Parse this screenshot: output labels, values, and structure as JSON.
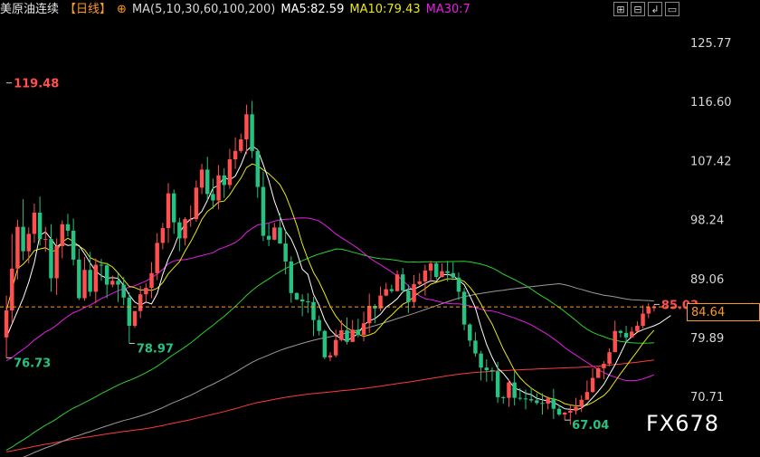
{
  "header": {
    "title": "美原油连续",
    "period": "【日线】",
    "ma_params": "MA(5,10,30,60,100,200)",
    "ma5": "MA5:82.59",
    "ma10": "MA10:79.43",
    "ma30": "MA30:7"
  },
  "toolbar": [
    "⊞",
    "⊟",
    "↲",
    "▭"
  ],
  "current_price": "84.64",
  "watermark": "FX678",
  "colors": {
    "background": "#000000",
    "up": "#ff4f4f",
    "down": "#26c281",
    "ma5": "#ffffff",
    "ma10": "#e8e814",
    "ma30": "#e61ee6",
    "ma60": "#2fd12f",
    "ma100": "#9a9a9a",
    "ma200": "#ff3a3a",
    "price_line": "#ff9a1f"
  },
  "chart_data": {
    "type": "candlestick",
    "ylim": [
      62.0,
      129.0
    ],
    "yticks": [
      "125.77",
      "116.60",
      "107.42",
      "98.24",
      "89.06",
      "79.89",
      "70.71"
    ],
    "grid": false,
    "current_price": 84.64,
    "annotations": [
      {
        "text": "119.48",
        "index": 0,
        "value": 119.48,
        "kind": "high"
      },
      {
        "text": "76.73",
        "index": 0,
        "value": 76.73,
        "kind": "low"
      },
      {
        "text": "78.97",
        "index": 22,
        "value": 78.97,
        "kind": "low"
      },
      {
        "text": "67.04",
        "index": 100,
        "value": 67.04,
        "kind": "low"
      },
      {
        "text": "85.03",
        "index": 116,
        "value": 85.03,
        "kind": "high"
      }
    ],
    "candles": [
      [
        79.9,
        84.1,
        86.4,
        76.7
      ],
      [
        84.1,
        90.6,
        96.0,
        82.2
      ],
      [
        90.6,
        97.1,
        98.2,
        88.9
      ],
      [
        97.1,
        93.3,
        101.4,
        91.9
      ],
      [
        93.3,
        96.0,
        97.0,
        91.4
      ],
      [
        96.0,
        99.3,
        100.7,
        94.6
      ],
      [
        99.3,
        95.2,
        101.8,
        94.2
      ],
      [
        95.2,
        95.2,
        97.1,
        93.2
      ],
      [
        95.2,
        89.1,
        97.5,
        87.0
      ],
      [
        89.1,
        94.1,
        95.3,
        86.5
      ],
      [
        94.1,
        97.5,
        98.1,
        92.2
      ],
      [
        97.5,
        96.5,
        99.1,
        95.6
      ],
      [
        96.5,
        92.0,
        98.4,
        91.1
      ],
      [
        92.0,
        86.0,
        93.7,
        85.7
      ],
      [
        86.0,
        90.4,
        92.4,
        85.6
      ],
      [
        90.4,
        87.0,
        93.2,
        86.3
      ],
      [
        87.0,
        91.2,
        92.2,
        85.2
      ],
      [
        91.2,
        91.1,
        92.1,
        88.7
      ],
      [
        91.1,
        88.1,
        91.5,
        86.0
      ],
      [
        88.1,
        88.7,
        89.5,
        87.7
      ],
      [
        88.7,
        88.1,
        89.8,
        85.4
      ],
      [
        88.1,
        86.1,
        89.3,
        84.9
      ],
      [
        86.1,
        81.7,
        86.9,
        79.0
      ],
      [
        81.7,
        84.0,
        84.0,
        81.4
      ],
      [
        84.0,
        86.6,
        87.9,
        82.9
      ],
      [
        86.6,
        87.6,
        88.3,
        85.4
      ],
      [
        87.6,
        89.9,
        91.6,
        86.0
      ],
      [
        89.9,
        94.6,
        96.1,
        88.8
      ],
      [
        94.6,
        96.9,
        97.7,
        93.6
      ],
      [
        96.9,
        102.3,
        103.9,
        94.6
      ],
      [
        102.3,
        97.8,
        102.9,
        96.0
      ],
      [
        97.8,
        95.3,
        98.5,
        93.3
      ],
      [
        95.3,
        98.3,
        98.6,
        94.2
      ],
      [
        98.3,
        98.3,
        100.4,
        97.1
      ],
      [
        98.3,
        103.2,
        104.3,
        97.9
      ],
      [
        103.2,
        106.0,
        106.9,
        102.2
      ],
      [
        106.0,
        102.2,
        108.0,
        101.2
      ],
      [
        102.2,
        101.2,
        104.6,
        99.9
      ],
      [
        101.2,
        105.1,
        106.7,
        99.8
      ],
      [
        105.1,
        103.6,
        106.2,
        101.6
      ],
      [
        103.6,
        107.6,
        109.2,
        103.0
      ],
      [
        107.6,
        108.9,
        111.0,
        106.1
      ],
      [
        108.9,
        110.7,
        111.6,
        108.6
      ],
      [
        110.7,
        114.6,
        116.1,
        108.4
      ],
      [
        114.6,
        108.9,
        116.7,
        107.8
      ],
      [
        108.9,
        103.3,
        109.1,
        101.6
      ],
      [
        103.3,
        95.7,
        105.7,
        94.9
      ],
      [
        95.7,
        95.1,
        97.6,
        94.1
      ],
      [
        95.1,
        97.0,
        97.7,
        95.0
      ],
      [
        97.0,
        94.5,
        99.2,
        94.5
      ],
      [
        94.5,
        91.7,
        96.5,
        89.7
      ],
      [
        91.7,
        86.8,
        92.5,
        85.3
      ],
      [
        86.8,
        85.8,
        86.9,
        85.7
      ],
      [
        85.8,
        85.5,
        86.6,
        83.2
      ],
      [
        85.5,
        85.4,
        86.8,
        83.7
      ],
      [
        85.4,
        82.6,
        86.2,
        80.1
      ],
      [
        82.6,
        80.9,
        83.3,
        80.2
      ],
      [
        80.9,
        76.8,
        81.1,
        76.5
      ],
      [
        76.8,
        77.1,
        77.6,
        76.2
      ],
      [
        77.1,
        79.5,
        81.1,
        76.8
      ],
      [
        79.5,
        81.0,
        82.6,
        79.3
      ],
      [
        81.0,
        79.2,
        83.0,
        78.8
      ],
      [
        79.2,
        81.1,
        82.6,
        79.2
      ],
      [
        81.1,
        80.3,
        82.8,
        79.9
      ],
      [
        80.3,
        82.1,
        83.9,
        79.3
      ],
      [
        82.1,
        84.8,
        86.7,
        80.6
      ],
      [
        84.8,
        84.4,
        85.1,
        82.1
      ],
      [
        84.4,
        86.4,
        87.8,
        84.0
      ],
      [
        86.4,
        87.4,
        88.4,
        86.3
      ],
      [
        87.4,
        87.1,
        88.1,
        86.8
      ],
      [
        87.1,
        89.7,
        90.3,
        87.0
      ],
      [
        89.7,
        87.2,
        90.7,
        86.8
      ],
      [
        87.2,
        85.4,
        88.1,
        83.7
      ],
      [
        85.4,
        88.2,
        89.6,
        84.7
      ],
      [
        88.2,
        88.6,
        89.9,
        88.0
      ],
      [
        88.6,
        90.3,
        91.2,
        86.4
      ],
      [
        90.3,
        91.4,
        91.8,
        88.5
      ],
      [
        91.4,
        89.3,
        91.6,
        88.9
      ],
      [
        89.3,
        90.2,
        91.4,
        89.2
      ],
      [
        90.2,
        89.9,
        91.8,
        88.6
      ],
      [
        89.9,
        89.2,
        91.6,
        88.8
      ],
      [
        89.2,
        87.0,
        90.0,
        85.7
      ],
      [
        87.0,
        81.9,
        87.6,
        81.0
      ],
      [
        81.9,
        79.4,
        82.1,
        78.5
      ],
      [
        79.4,
        77.4,
        80.7,
        76.9
      ],
      [
        77.4,
        75.2,
        77.8,
        73.2
      ],
      [
        75.2,
        74.8,
        76.5,
        73.0
      ],
      [
        74.8,
        74.6,
        75.2,
        73.1
      ],
      [
        74.6,
        70.6,
        76.1,
        69.7
      ],
      [
        70.6,
        70.5,
        70.8,
        69.6
      ],
      [
        70.5,
        72.9,
        73.3,
        69.1
      ],
      [
        72.9,
        70.5,
        74.6,
        69.3
      ],
      [
        70.5,
        70.4,
        72.0,
        70.1
      ],
      [
        70.4,
        70.3,
        71.8,
        68.7
      ],
      [
        70.3,
        70.1,
        72.1,
        69.8
      ],
      [
        70.1,
        69.7,
        71.2,
        69.4
      ],
      [
        69.7,
        69.6,
        71.2,
        67.9
      ],
      [
        69.6,
        70.4,
        70.7,
        68.7
      ],
      [
        70.4,
        68.8,
        71.9,
        67.2
      ],
      [
        68.8,
        67.9,
        69.4,
        67.7
      ],
      [
        67.9,
        68.2,
        68.3,
        67.0
      ],
      [
        68.2,
        68.5,
        69.5,
        66.3
      ],
      [
        68.5,
        69.1,
        70.5,
        67.9
      ],
      [
        69.1,
        70.2,
        70.9,
        68.3
      ],
      [
        70.2,
        71.4,
        73.2,
        70.2
      ],
      [
        71.4,
        73.6,
        75.1,
        71.3
      ],
      [
        73.6,
        75.1,
        75.3,
        74.6
      ],
      [
        75.1,
        75.8,
        76.2,
        73.4
      ],
      [
        75.8,
        77.6,
        78.2,
        75.4
      ],
      [
        77.6,
        80.9,
        82.5,
        77.6
      ],
      [
        80.9,
        80.6,
        81.1,
        79.9
      ],
      [
        80.6,
        79.9,
        81.7,
        79.1
      ],
      [
        79.9,
        80.8,
        81.5,
        80.1
      ],
      [
        80.8,
        81.7,
        82.4,
        81.2
      ],
      [
        81.7,
        83.6,
        84.9,
        81.3
      ],
      [
        83.6,
        84.6,
        85.2,
        82.9
      ],
      [
        84.6,
        84.6,
        85.0,
        83.9
      ]
    ],
    "ma": {
      "ma5": [
        79.9,
        82.0,
        84.0,
        86.0,
        88.5,
        91.5,
        95.8,
        96.3,
        95.2,
        94.0,
        94.6,
        94.2,
        94.3,
        94.2,
        92.9,
        91.5,
        90.2,
        89.5,
        89.1,
        89.2,
        89.1,
        88.0,
        86.5,
        85.4,
        84.9,
        85.4,
        85.1,
        86.7,
        89.7,
        92.1,
        93.9,
        96.2,
        97.5,
        98.3,
        98.6,
        99.5,
        101.2,
        103.1,
        103.6,
        104.8,
        104.4,
        105.0,
        106.7,
        108.9,
        109.7,
        109.1,
        106.8,
        104.3,
        101.1,
        98.7,
        96.4,
        95.2,
        93.2,
        90.5,
        89.7,
        86.6,
        84.9,
        82.6,
        81.1,
        80.2,
        79.7,
        79.4,
        79.9,
        80.5,
        81.8,
        82.5,
        82.8,
        83.5,
        84.6,
        85.2,
        85.9,
        87.0,
        87.4,
        87.4,
        87.8,
        88.3,
        88.7,
        88.6,
        89.6,
        89.7,
        89.5,
        88.8,
        88.1,
        86.4,
        84.5,
        81.5,
        78.8,
        76.8,
        75.1,
        74.3,
        73.2,
        72.0,
        71.7,
        71.2,
        71.0,
        70.4,
        70.2,
        70.0,
        69.8,
        69.3,
        68.8,
        68.7,
        68.6,
        68.9,
        69.6,
        70.5,
        71.5,
        72.6,
        74.1,
        75.6,
        77.4,
        79.2,
        80.0,
        80.7,
        81.1,
        81.4,
        81.7,
        82.1,
        82.7,
        83.3
      ]
    }
  }
}
